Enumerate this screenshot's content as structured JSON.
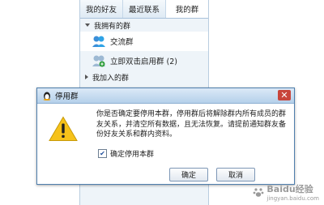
{
  "contacts_panel": {
    "tabs": [
      {
        "label": "我的好友"
      },
      {
        "label": "最近联系"
      },
      {
        "label": "我的群"
      }
    ],
    "owned_groups_header": "我拥有的群",
    "groups": [
      {
        "name": "交流群"
      },
      {
        "name": "立即双击启用群 (2)"
      }
    ],
    "joined_groups_header": "我加入的群"
  },
  "dialog": {
    "title": "停用群",
    "message": "你是否确定要停用本群，停用群后将解除群内所有成员的群友关系，并清空所有数据，且无法恢复。请提前通知群友备份好友关系和群内资料。",
    "checkbox_label": "确定停用本群",
    "checkbox_checked": true,
    "ok_label": "确定",
    "cancel_label": "取消"
  },
  "watermark": {
    "text": "Baidu经验",
    "sub": "jingyan.baidu.com"
  },
  "colors": {
    "warning_yellow": "#f6c21a",
    "titlebar": "#b5d0ea",
    "close_red": "#c8453b"
  }
}
